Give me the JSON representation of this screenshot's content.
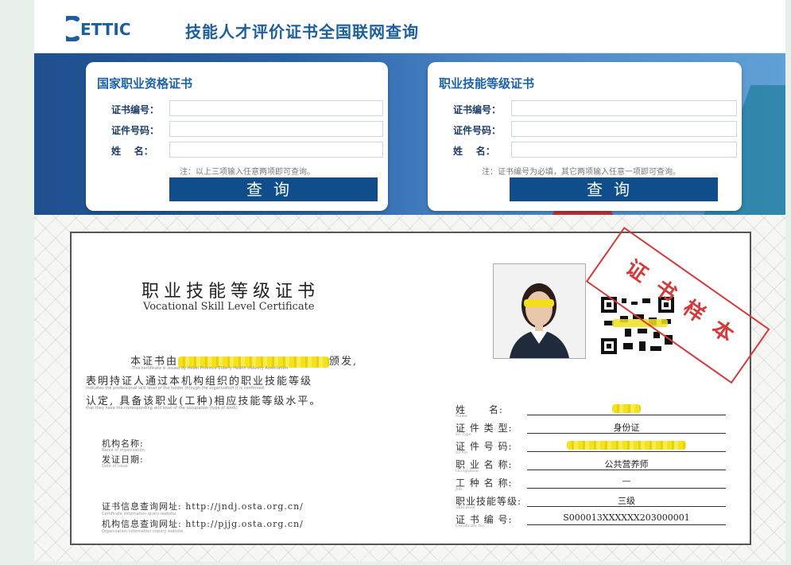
{
  "header": {
    "logo_text": "ETTIC",
    "title": "技能人才评价证书全国联网查询"
  },
  "query_left": {
    "title": "国家职业资格证书",
    "fields": [
      {
        "label": "证书编号：",
        "value": ""
      },
      {
        "label": "证件号码：",
        "value": ""
      },
      {
        "label": "姓    名：",
        "value": ""
      }
    ],
    "note": "注：以上三项输入任意两项即可查询。",
    "button": "查询"
  },
  "query_right": {
    "title": "职业技能等级证书",
    "fields": [
      {
        "label": "证书编号：",
        "value": ""
      },
      {
        "label": "证件号码：",
        "value": ""
      },
      {
        "label": "姓    名：",
        "value": ""
      }
    ],
    "note": "注：证书编号为必填，其它两项输入任意一项即可查询。",
    "button": "查询"
  },
  "certificate": {
    "title_cn": "职业技能等级证书",
    "title_en": "Vocational Skill Level Certificate",
    "stamp": "证书样本",
    "body": {
      "line1_prefix": "本证书由",
      "line1_suffix": "颁发,",
      "line1_en": "This certificate is issued by Hebei Province Elderly Health Industry Association",
      "line2": "表明持证人通过本机构组织的职业技能等级",
      "line2_en": "Indicates the professional skill level of the holder through the organization It is confirmed",
      "line3": "认定, 具备该职业(工种)相应技能等级水平。",
      "line3_en": "that they have the corresponding skill level of the occupation (type of work)"
    },
    "org_name_label": "机构名称:",
    "org_name_en": "Name of organization",
    "issue_date_label": "发证日期:",
    "issue_date_en": "Date of issue",
    "query_site_label": "证书信息查询网址:",
    "query_site_url": "http://jndj.osta.org.cn/",
    "query_site_en": "Certificate information query website",
    "org_site_label": "机构信息查询网址:",
    "org_site_url": "http://pjjg.osta.org.cn/",
    "org_site_en": "Organization information inquiry website",
    "fields": [
      {
        "label": "姓      名:",
        "sub": "Name",
        "value": ""
      },
      {
        "label": "证 件 类 型:",
        "sub": "ID Type",
        "value": "身份证"
      },
      {
        "label": "证 件 号 码:",
        "sub": "ID No",
        "value": ""
      },
      {
        "label": "职 业 名 称:",
        "sub": "Occupation",
        "value": "公共营养师"
      },
      {
        "label": "工 种 名 称:",
        "sub": "Job",
        "value": "—"
      },
      {
        "label": "职业技能等级:",
        "sub": "Skill level",
        "value": "三级"
      },
      {
        "label": "证 书 编 号:",
        "sub": "Certificate No",
        "value": "S000013XXXXXX203000001"
      }
    ]
  },
  "colors": {
    "brand_blue": "#1d5e9c",
    "button_blue": "#0f4e8a",
    "stamp_red": "#d33a3a"
  }
}
